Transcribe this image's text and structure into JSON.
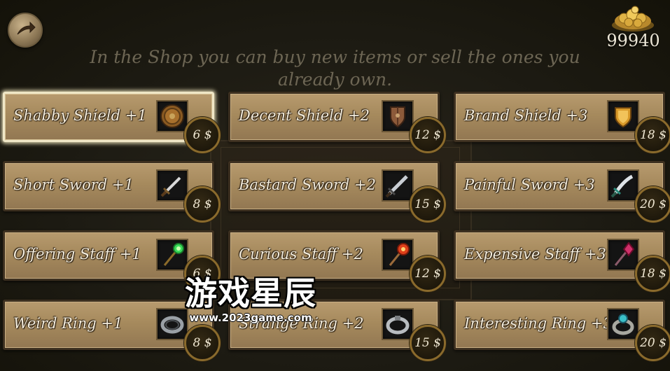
{
  "header": {
    "back_icon": "back-arrow-icon",
    "coins_icon": "gold-coins-icon",
    "coins": "99940"
  },
  "instructions": "In the Shop you can buy new items or sell the ones you already own.",
  "items": [
    {
      "name": "Shabby Shield +1",
      "price": "6 $",
      "icon": "round-shield-icon",
      "selected": true
    },
    {
      "name": "Decent Shield +2",
      "price": "12 $",
      "icon": "wooden-shield-icon",
      "selected": false
    },
    {
      "name": "Brand Shield +3",
      "price": "18 $",
      "icon": "gold-shield-icon",
      "selected": false
    },
    {
      "name": "Short Sword +1",
      "price": "8 $",
      "icon": "short-sword-icon",
      "selected": false
    },
    {
      "name": "Bastard Sword +2",
      "price": "15 $",
      "icon": "bastard-sword-icon",
      "selected": false
    },
    {
      "name": "Painful Sword +3",
      "price": "20 $",
      "icon": "curved-sword-icon",
      "selected": false
    },
    {
      "name": "Offering Staff +1",
      "price": "6 $",
      "icon": "green-staff-icon",
      "selected": false
    },
    {
      "name": "Curious Staff +2",
      "price": "12 $",
      "icon": "fire-staff-icon",
      "selected": false
    },
    {
      "name": "Expensive Staff +3",
      "price": "18 $",
      "icon": "crystal-staff-icon",
      "selected": false
    },
    {
      "name": "Weird Ring +1",
      "price": "8 $",
      "icon": "iron-ring-icon",
      "selected": false
    },
    {
      "name": "Strange Ring +2",
      "price": "15 $",
      "icon": "silver-ring-icon",
      "selected": false
    },
    {
      "name": "Interesting Ring +3",
      "price": "20 $",
      "icon": "jeweled-ring-icon",
      "selected": false
    }
  ],
  "watermark": {
    "title": "游戏星辰",
    "url": "www.2023game.com"
  }
}
